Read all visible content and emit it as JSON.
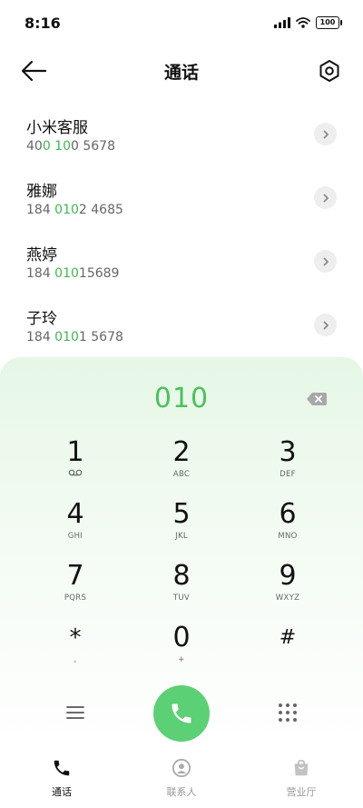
{
  "status_bar": {
    "time": "8:16",
    "battery": "100"
  },
  "header": {
    "title": "通话"
  },
  "contacts": [
    {
      "name": "小米客服",
      "number_parts": [
        "40",
        "0 10",
        "0 5678"
      ]
    },
    {
      "name": "雅娜",
      "number_parts": [
        "184 ",
        "010",
        "2 4685"
      ]
    },
    {
      "name": "燕婷",
      "number_parts": [
        "184 ",
        "010",
        "15689"
      ]
    },
    {
      "name": "子玲",
      "number_parts": [
        "184 ",
        "010",
        "1 5678"
      ]
    }
  ],
  "dialpad": {
    "dialed": "010",
    "keys": [
      {
        "digit": "1",
        "sub": ""
      },
      {
        "digit": "2",
        "sub": "ABC"
      },
      {
        "digit": "3",
        "sub": "DEF"
      },
      {
        "digit": "4",
        "sub": "GHI"
      },
      {
        "digit": "5",
        "sub": "JKL"
      },
      {
        "digit": "6",
        "sub": "MNO"
      },
      {
        "digit": "7",
        "sub": "PQRS"
      },
      {
        "digit": "8",
        "sub": "TUV"
      },
      {
        "digit": "9",
        "sub": "WXYZ"
      },
      {
        "digit": "*",
        "sub": ","
      },
      {
        "digit": "0",
        "sub": "+"
      },
      {
        "digit": "#",
        "sub": ""
      }
    ]
  },
  "bottom_nav": {
    "items": [
      {
        "label": "通话",
        "active": true
      },
      {
        "label": "联系人",
        "active": false
      },
      {
        "label": "营业厅",
        "active": false
      }
    ]
  },
  "colors": {
    "accent_green": "#49c25a",
    "call_button": "#5cd075"
  }
}
